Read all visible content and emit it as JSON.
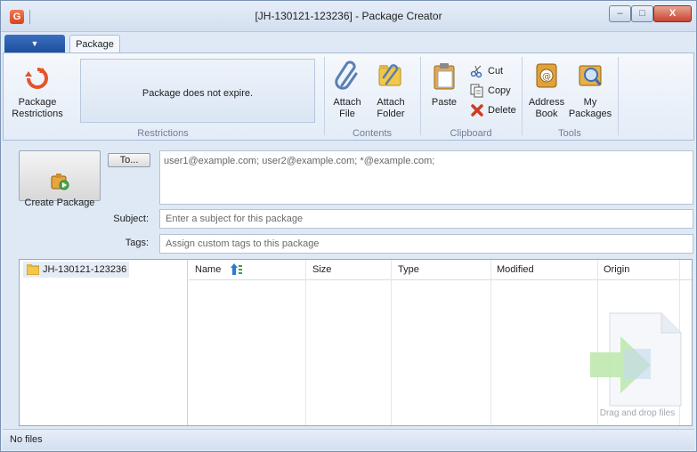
{
  "window": {
    "title": "[JH-130121-123236] - Package Creator",
    "app_icon_glyph": "G",
    "minimize": "–",
    "maximize": "□",
    "close": "X"
  },
  "ribbon": {
    "app_menu_arrow": "▼",
    "tabs": [
      {
        "label": "Package",
        "active": true
      }
    ],
    "groups": {
      "restrictions": {
        "label": "Restrictions",
        "package_restrictions": "Package\nRestrictions",
        "status_text": "Package does not expire."
      },
      "contents": {
        "label": "Contents",
        "attach_file": "Attach\nFile",
        "attach_folder": "Attach\nFolder"
      },
      "clipboard": {
        "label": "Clipboard",
        "paste": "Paste",
        "cut": "Cut",
        "copy": "Copy",
        "delete": "Delete"
      },
      "tools": {
        "label": "Tools",
        "address_book": "Address\nBook",
        "my_packages": "My\nPackages"
      }
    }
  },
  "form": {
    "create_package": "Create Package",
    "to_button": "To...",
    "recipients_placeholder": "user1@example.com; user2@example.com; *@example.com;",
    "subject_label": "Subject:",
    "subject_placeholder": "Enter a subject for this package",
    "tags_label": "Tags:",
    "tags_placeholder": "Assign custom tags to this package"
  },
  "files": {
    "tree_root": "JH-130121-123236",
    "columns": [
      "Name",
      "Size",
      "Type",
      "Modified",
      "Origin"
    ],
    "rows": [],
    "drop_hint": "Drag and drop files"
  },
  "status": {
    "text": "No files"
  },
  "colors": {
    "accent_orange": "#e5532a",
    "ribbon_blue": "#dfe9f5",
    "drop_arrow_green": "#b9e6a8"
  }
}
